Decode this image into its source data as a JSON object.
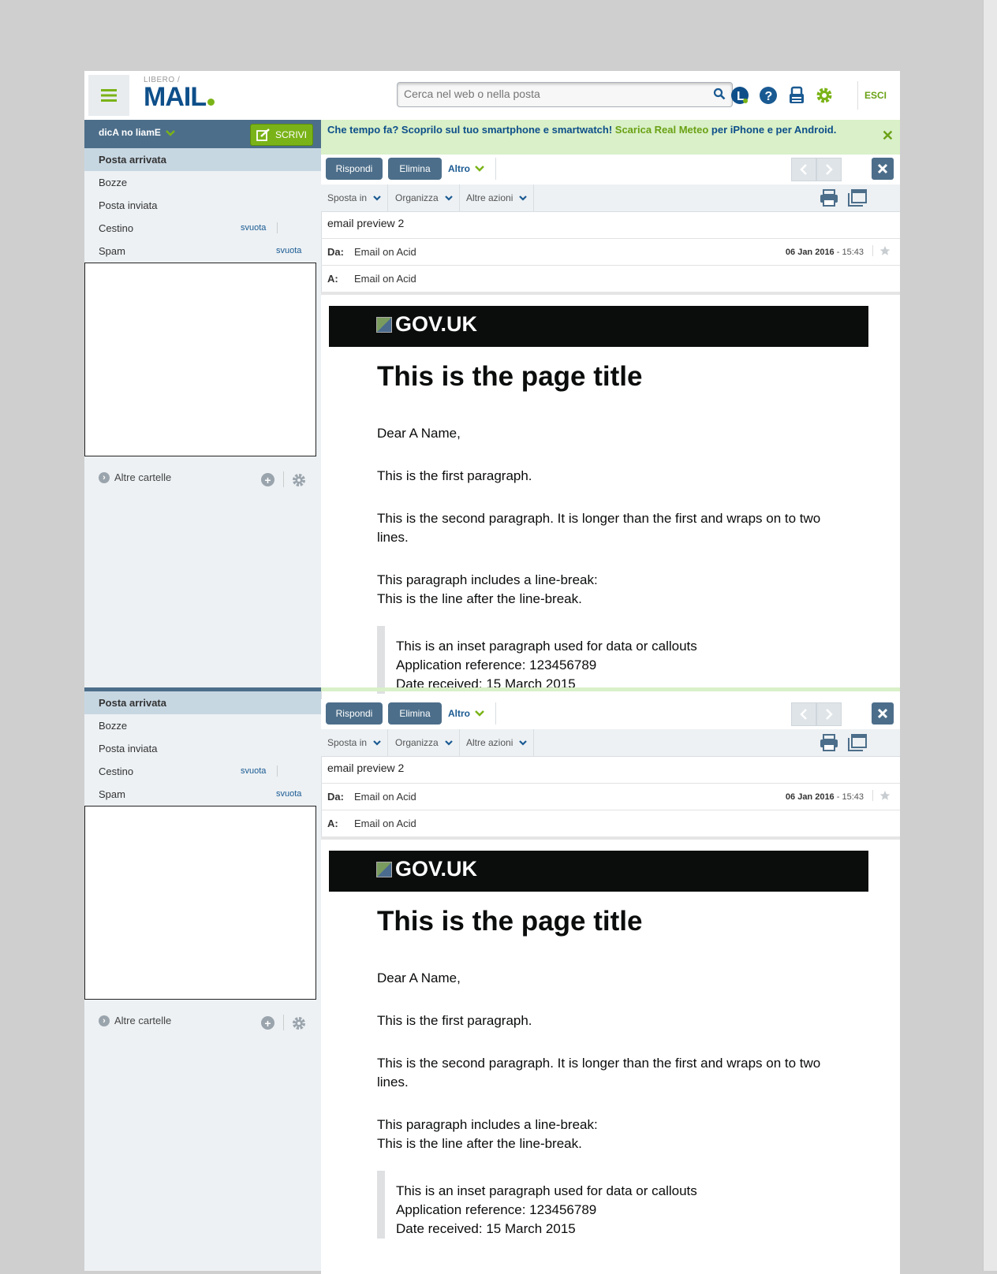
{
  "header": {
    "logo_top": "LIBERO",
    "logo_slash": "/",
    "logo_main": "MAIL",
    "search_placeholder": "Cerca nel web o nella posta",
    "logout": "ESCI"
  },
  "sidebar": {
    "user": "dicA no liamE",
    "compose": "SCRIVI",
    "folders": [
      {
        "name": "Posta arrivata",
        "action": ""
      },
      {
        "name": "Bozze",
        "action": ""
      },
      {
        "name": "Posta inviata",
        "action": ""
      },
      {
        "name": "Cestino",
        "action": "svuota"
      },
      {
        "name": "Spam",
        "action": "svuota"
      }
    ],
    "more_folders": "Altre cartelle"
  },
  "promo": {
    "text_a": "Che tempo fa? Scoprilo sul tuo smartphone e smartwatch! ",
    "link": "Scarica Real Meteo",
    "text_b": " per iPhone e per Android."
  },
  "toolbar": {
    "reply": "Rispondi",
    "delete": "Elimina",
    "more": "Altro",
    "move": "Sposta in",
    "organize": "Organizza",
    "other_actions": "Altre azioni"
  },
  "message": {
    "subject": "email preview 2",
    "from_label": "Da:",
    "from": "Email on Acid",
    "to_label": "A:",
    "to": "Email on Acid",
    "date": "06 Jan 2016",
    "time": " - 15:43"
  },
  "email_body": {
    "brand": "GOV.UK",
    "title": "This is the page title",
    "greeting": "Dear A Name,",
    "p1": "This is the first paragraph.",
    "p2": "This is the second paragraph. It is longer than the first and wraps on to two lines.",
    "p3a": "This paragraph includes a line-break:",
    "p3b": "This is the line after the line-break.",
    "inset1": "This is an inset paragraph used for data or callouts",
    "inset2": "Application reference: 123456789",
    "inset3": "Date received: 15 March 2015"
  },
  "colors": {
    "accent_green": "#7ab317",
    "nav_blue": "#4c6e8a",
    "brand_blue": "#0e4f8a",
    "gov_black": "#0b0c0c"
  }
}
